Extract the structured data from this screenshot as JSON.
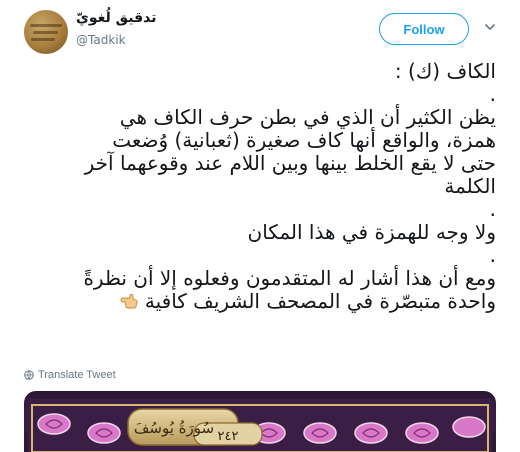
{
  "user": {
    "name": "تدقيق لُغويّ",
    "handle": "@Tadkik"
  },
  "actions": {
    "follow_label": "Follow"
  },
  "tweet": {
    "lines": [
      "الكاف (ك) :",
      ".",
      "يظن الكثير أن الذي في بطن حرف الكاف هي",
      "همزة، والواقع أنها كاف صغيرة (ثعبانية) وُضعت",
      "حتى لا يقع الخلط بينها وبين اللام عند وقوعهما آخر",
      "الكلمة",
      ".",
      "ولا وجه للهمزة في هذا المكان",
      ".",
      "ومع أن هذا أشار له المتقدمون وفعلوه إلا أن نظرةً",
      "واحدة متبصّرة  في المصحف الشريف كافية"
    ]
  },
  "footer": {
    "translate_label": "Translate Tweet"
  },
  "media": {
    "banner_number": "٢٤٢",
    "banner_title": "سُورَةُ يُوسُفَ"
  },
  "icons": {
    "avatar": "avatar-image",
    "menu": "chevron-down-icon",
    "translate": "globe-icon",
    "emoji": "backhand-index-pointing-left-icon"
  },
  "colors": {
    "accent": "#1da1f2",
    "secondary_text": "#657786",
    "text": "#14171a"
  }
}
